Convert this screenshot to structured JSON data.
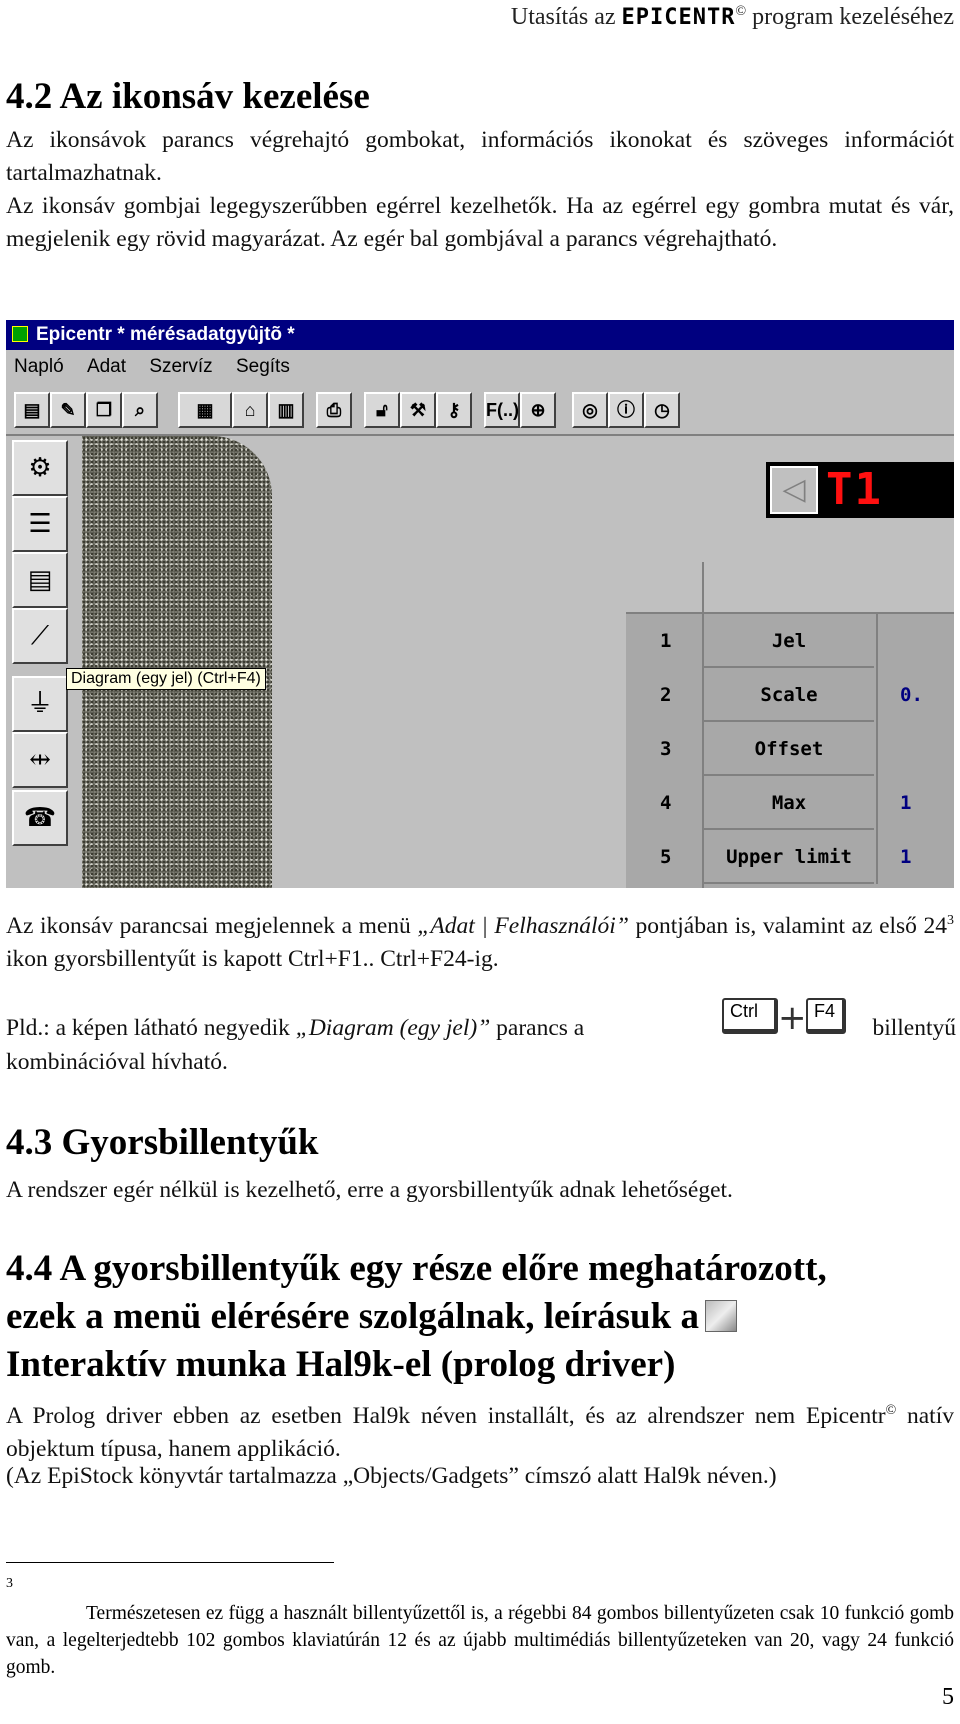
{
  "header": {
    "prefix": "Utasítás az",
    "brand": "EPICENTR",
    "copyright": "©",
    "suffix": "program kezeléséhez"
  },
  "section_4_2": {
    "title": "4.2 Az ikonsáv kezelése",
    "para1": "Az ikonsávok parancs végrehajtó gombokat, információs ikonokat és szöveges információt tartalmazhatnak.",
    "para2": "Az ikonsáv gombjai legegyszerűbben egérrel kezelhetők. Ha az egérrel egy gombra mutat és vár, megjelenik egy rövid magyarázat. Az egér bal gombjával a parancs végrehajtható."
  },
  "screenshot": {
    "window_title": "Epicentr * mérésadatgyûjtõ *",
    "menu": [
      "Napló",
      "Adat",
      "Szervíz",
      "Segíts"
    ],
    "toolbar_label": "F(..)",
    "tooltip": "Diagram (egy jel) (Ctrl+F4)",
    "display_text": "T1",
    "grid_rows": [
      {
        "num": "1",
        "label": "Jel",
        "value": ""
      },
      {
        "num": "2",
        "label": "Scale",
        "value": "0."
      },
      {
        "num": "3",
        "label": "Offset",
        "value": ""
      },
      {
        "num": "4",
        "label": "Max",
        "value": "1"
      },
      {
        "num": "5",
        "label": "Upper limit",
        "value": "1"
      }
    ]
  },
  "para3": {
    "text_a": "Az ikonsáv parancsai megjelennek a menü ",
    "menu_path": "„Adat | Felhasználói”",
    "text_b": " pontjában is, valamint az első 24",
    "footnote_ref": "3",
    "text_c": " ikon gyorsbillentyűt is kapott Ctrl+F1.. Ctrl+F24-ig."
  },
  "para4": {
    "text_a": "Pld.: a képen látható negyedik ",
    "command": "„Diagram (egy jel)”",
    "text_b": " parancs a",
    "text_c": "billentyű kombinációval hívható.",
    "key1": "Ctrl",
    "plus": "+",
    "key2": "F4"
  },
  "section_4_3": {
    "title": "4.3 Gyorsbillentyűk",
    "para": "A rendszer egér nélkül is kezelhető, erre a gyorsbillentyűk adnak lehetőséget."
  },
  "section_4_4": {
    "title_line1": "4.4 A gyorsbillentyűk egy része előre meghatározott,",
    "title_line2": "ezek a menü elérésére szolgálnak, leírásuk a",
    "title_line3": "Interaktív munka Hal9k-el (prolog driver)",
    "para1_a": "A Prolog driver ebben az esetben Hal9k néven installált, és az alrendszer nem Epicentr",
    "para1_sup": "©",
    "para1_b": " natív objektum típusa, hanem applikáció.",
    "para2": "(Az EpiStock könyvtár tartalmazza „Objects/Gadgets” címszó alatt Hal9k néven.)"
  },
  "footnote": {
    "number": "3",
    "text": "Természetesen ez függ a használt billentyűzettől is, a régebbi 84 gombos billentyűzeten csak 10 funkció gomb van, a legelterjedtebb 102 gombos klaviatúrán 12 és az újabb multimédiás billentyűzeteken van 20, vagy 24 funkció gomb."
  },
  "page_number": "5"
}
